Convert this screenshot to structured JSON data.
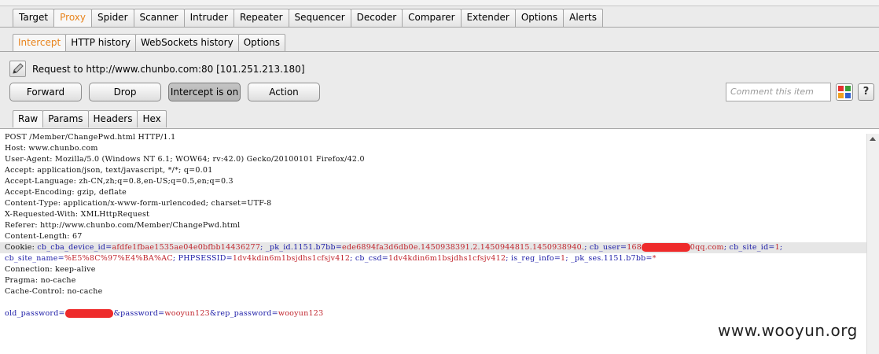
{
  "main_tabs": [
    "Target",
    "Proxy",
    "Spider",
    "Scanner",
    "Intruder",
    "Repeater",
    "Sequencer",
    "Decoder",
    "Comparer",
    "Extender",
    "Options",
    "Alerts"
  ],
  "sub_tabs": [
    "Intercept",
    "HTTP history",
    "WebSockets history",
    "Options"
  ],
  "request_info": "Request to http://www.chunbo.com:80  [101.251.213.180]",
  "buttons": {
    "forward": "Forward",
    "drop": "Drop",
    "intercept": "Intercept is on",
    "action": "Action"
  },
  "comment_placeholder": "Comment this item",
  "help_label": "?",
  "view_tabs": [
    "Raw",
    "Params",
    "Headers",
    "Hex"
  ],
  "request": {
    "line1": "POST /Member/ChangePwd.html HTTP/1.1",
    "host": "Host: www.chunbo.com",
    "user_agent": "User-Agent: Mozilla/5.0 (Windows NT 6.1; WOW64; rv:42.0) Gecko/20100101 Firefox/42.0",
    "accept": "Accept: application/json, text/javascript, */*; q=0.01",
    "accept_language": "Accept-Language: zh-CN,zh;q=0.8,en-US;q=0.5,en;q=0.3",
    "accept_encoding": "Accept-Encoding: gzip, deflate",
    "content_type": "Content-Type: application/x-www-form-urlencoded; charset=UTF-8",
    "x_requested_with": "X-Requested-With: XMLHttpRequest",
    "referer": "Referer: http://www.chunbo.com/Member/ChangePwd.html",
    "content_length": "Content-Length: 67",
    "cookie_label": "Cookie: ",
    "cookie_part1": "cb_cba_device_id=",
    "cookie_val1": "afdfe1fbae1535ae04e0bfbb14436277",
    "cookie_part2": "; _pk_id.1151.b7bb=",
    "cookie_val2": "ede6894fa3d6db0e.1450938391.2.1450944815.1450938940.",
    "cookie_part3": "; cb_user=",
    "cookie_val3a": "168",
    "cookie_val3b": "0qq.com",
    "cookie_part4": "; cb_site_id=",
    "cookie_val4": "1",
    "cookie_line2_k1": "cb_site_name=",
    "cookie_line2_v1": "%E5%8C%97%E4%BA%AC",
    "cookie_line2_k2": "; PHPSESSID=",
    "cookie_line2_v2": "1dv4kdin6m1bsjdhs1cfsjv412",
    "cookie_line2_k3": "; cb_csd=",
    "cookie_line2_v3": "1dv4kdin6m1bsjdhs1cfsjv412",
    "cookie_line2_k4": "; is_reg_info=",
    "cookie_line2_v4": "1",
    "cookie_line2_k5": "; _pk_ses.1151.b7bb=",
    "cookie_line2_v5": "*",
    "connection": "Connection: keep-alive",
    "pragma": "Pragma: no-cache",
    "cache_control": "Cache-Control: no-cache",
    "body_k1": "old_password=",
    "body_k2": "&password=",
    "body_v2": "wooyun123",
    "body_k3": "&rep_password=",
    "body_v3": "wooyun123"
  },
  "watermark": "www.wooyun.org",
  "colors": {
    "accent_orange": "#e8841d",
    "param_blue": "#1a1aa6",
    "value_red": "#c0242c",
    "redaction": "#ee2b2b"
  }
}
